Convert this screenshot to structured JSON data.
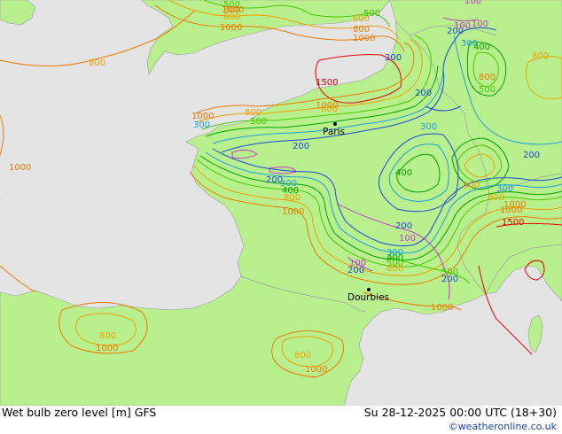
{
  "title": "Wet bulb zero level [m] GFS",
  "timestamp": "Su 28-12-2025 00:00 UTC (18+30)",
  "credit": "©weatheronline.co.uk",
  "colors": {
    "land": "#b9f08e",
    "sea": "#e4e4e4",
    "c100": "#c838c8",
    "c200": "#1e46dc",
    "c300": "#1ea0dc",
    "c400": "#00a000",
    "c500": "#46c800",
    "c800": "#f0a000",
    "c1000": "#f07800",
    "c1500": "#e60000"
  },
  "cities": [
    {
      "name": "Paris"
    },
    {
      "name": "Dourbies"
    }
  ],
  "contour_labels": [
    {
      "text": "500",
      "color": "c500"
    },
    {
      "text": "800",
      "color": "c800"
    },
    {
      "text": "1000",
      "color": "c1000"
    },
    {
      "text": "600",
      "color": "c800"
    },
    {
      "text": "800",
      "color": "c1000"
    },
    {
      "text": "1000",
      "color": "c1000"
    },
    {
      "text": "500",
      "color": "c500"
    },
    {
      "text": "100",
      "color": "c100"
    },
    {
      "text": "200",
      "color": "c200"
    },
    {
      "text": "300",
      "color": "c300"
    },
    {
      "text": "400",
      "color": "c400"
    },
    {
      "text": "800",
      "color": "c800"
    },
    {
      "text": "500",
      "color": "c500"
    },
    {
      "text": "800",
      "color": "c1000"
    },
    {
      "text": "1500",
      "color": "c1500"
    },
    {
      "text": "1000",
      "color": "c1000"
    },
    {
      "text": "800",
      "color": "c800"
    },
    {
      "text": "200",
      "color": "c200"
    },
    {
      "text": "1000",
      "color": "c1000"
    },
    {
      "text": "800",
      "color": "c800"
    },
    {
      "text": "500",
      "color": "c500"
    },
    {
      "text": "300",
      "color": "c300"
    },
    {
      "text": "200",
      "color": "c200"
    },
    {
      "text": "300",
      "color": "c300"
    },
    {
      "text": "400",
      "color": "c400"
    },
    {
      "text": "200",
      "color": "c200"
    },
    {
      "text": "200",
      "color": "c200"
    },
    {
      "text": "300",
      "color": "c300"
    },
    {
      "text": "400",
      "color": "c400"
    },
    {
      "text": "800",
      "color": "c800"
    },
    {
      "text": "1000",
      "color": "c1000"
    },
    {
      "text": "300",
      "color": "c300"
    },
    {
      "text": "800",
      "color": "c800"
    },
    {
      "text": "1000",
      "color": "c1000"
    },
    {
      "text": "1500",
      "color": "c1500"
    },
    {
      "text": "200",
      "color": "c200"
    },
    {
      "text": "200",
      "color": "c200"
    },
    {
      "text": "100",
      "color": "c100"
    },
    {
      "text": "300",
      "color": "c300"
    },
    {
      "text": "400",
      "color": "c400"
    },
    {
      "text": "500",
      "color": "c500"
    },
    {
      "text": "800",
      "color": "c800"
    },
    {
      "text": "1000",
      "color": "c1000"
    },
    {
      "text": "100",
      "color": "c100"
    },
    {
      "text": "200",
      "color": "c200"
    },
    {
      "text": "100",
      "color": "c100"
    },
    {
      "text": "200",
      "color": "c200"
    },
    {
      "text": "500",
      "color": "c500"
    },
    {
      "text": "800",
      "color": "c800"
    },
    {
      "text": "1000",
      "color": "c1000"
    },
    {
      "text": "800",
      "color": "c800"
    },
    {
      "text": "1000",
      "color": "c1000"
    },
    {
      "text": "800",
      "color": "c800"
    },
    {
      "text": "1000",
      "color": "c1000"
    },
    {
      "text": "1000",
      "color": "c1000"
    },
    {
      "text": "800",
      "color": "c800"
    },
    {
      "text": "100",
      "color": "c100"
    },
    {
      "text": "1000",
      "color": "c1000"
    },
    {
      "text": "800",
      "color": "c1000"
    }
  ]
}
